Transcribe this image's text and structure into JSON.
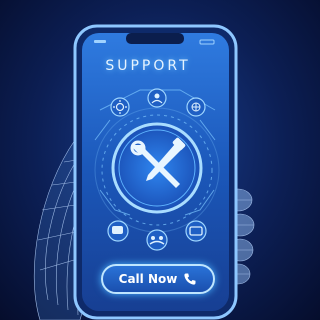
{
  "app": {
    "title": "SUPPORT"
  },
  "call_button": {
    "label": "Call Now",
    "icon": "phone-icon"
  },
  "icons": {
    "center": "wrench-screwdriver-icon",
    "top_left": "gear-icon",
    "top_center": "user-icon",
    "top_right": "globe-icon",
    "bottom_left": "chat-icon",
    "bottom_center": "group-icon",
    "bottom_right": "message-icon"
  },
  "colors": {
    "accent": "#3aa8ff",
    "glow": "#6fc8ff",
    "background": "#0c1f55",
    "phone_body": "#8ec7ff"
  }
}
